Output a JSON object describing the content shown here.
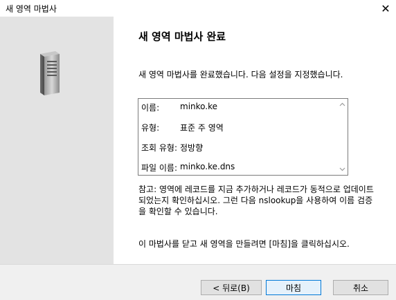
{
  "window": {
    "title": "새 영역 마법사",
    "close_glyph": "✕"
  },
  "page": {
    "heading": "새 영역 마법사 완료",
    "intro": "새 영역 마법사를 완료했습니다. 다음 설정을 지정했습니다."
  },
  "summary": [
    {
      "key": "이름:",
      "value": "minko.ke"
    },
    {
      "key": "유형:",
      "value": "표준 주 영역"
    },
    {
      "key": "조회 유형:",
      "value": "정방향"
    },
    {
      "key": "파일 이름:",
      "value": "minko.ke.dns"
    }
  ],
  "note": "참고: 영역에 레코드를 지금 추가하거나 레코드가 동적으로 업데이트되었는지 확인하십시오. 그런 다음 nslookup을 사용하여 이름 검증을 확인할 수 있습니다.",
  "finish_hint": "이 마법사를 닫고 새 영역을 만들려면 [마침]을 클릭하십시오.",
  "buttons": {
    "back": "< 뒤로(B)",
    "finish": "마침",
    "cancel": "취소"
  },
  "icons": {
    "left_panel": "server-icon",
    "close": "close-icon",
    "scroll_up": "chevron-up-icon",
    "scroll_down": "chevron-down-icon"
  },
  "colors": {
    "finish_border": "#0078d7",
    "left_panel_bg": "#e3e3e3"
  }
}
